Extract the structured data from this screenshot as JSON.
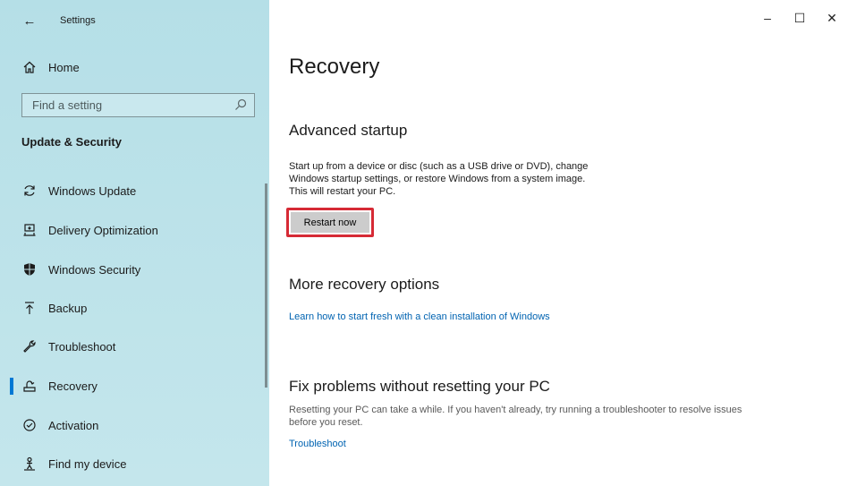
{
  "window": {
    "title": "Settings",
    "back_icon": "←",
    "controls": {
      "minimize": "–",
      "maximize": "☐",
      "close": "✕"
    }
  },
  "sidebar": {
    "home_label": "Home",
    "search": {
      "placeholder": "Find a setting"
    },
    "section_heading": "Update & Security",
    "items": [
      {
        "label": "Windows Update",
        "icon": "sync-icon",
        "active": false
      },
      {
        "label": "Delivery Optimization",
        "icon": "delivery-optimization-icon",
        "active": false
      },
      {
        "label": "Windows Security",
        "icon": "shield-icon",
        "active": false
      },
      {
        "label": "Backup",
        "icon": "backup-arrow-icon",
        "active": false
      },
      {
        "label": "Troubleshoot",
        "icon": "wrench-icon",
        "active": false
      },
      {
        "label": "Recovery",
        "icon": "recovery-icon",
        "active": true
      },
      {
        "label": "Activation",
        "icon": "check-circle-icon",
        "active": false
      },
      {
        "label": "Find my device",
        "icon": "person-location-icon",
        "active": false
      }
    ]
  },
  "main": {
    "title": "Recovery",
    "advanced_startup": {
      "heading": "Advanced startup",
      "description_lines": [
        "Start up from a device or disc (such as a USB drive or DVD), change",
        "Windows startup settings, or restore Windows from a system image.",
        "This will restart your PC."
      ],
      "button_label": "Restart now"
    },
    "more_options": {
      "heading": "More recovery options",
      "link": "Learn how to start fresh with a clean installation of Windows"
    },
    "fix_problems": {
      "heading": "Fix problems without resetting your PC",
      "description_lines": [
        "Resetting your PC can take a while. If you haven't already, try running a troubleshooter to resolve issues",
        "before you reset."
      ],
      "link": "Troubleshoot"
    }
  },
  "colors": {
    "accent": "#0078d4",
    "link": "#0063b1",
    "highlight_border": "#d62a35",
    "sidebar_bg": "#b5dfe7"
  }
}
